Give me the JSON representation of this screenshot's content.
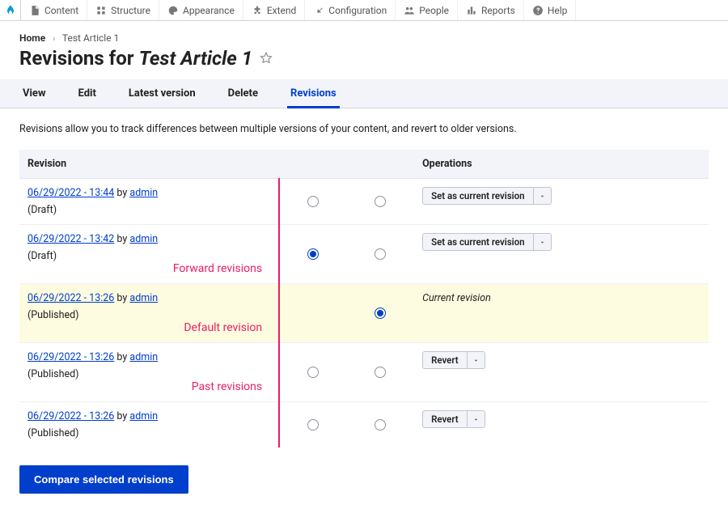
{
  "toolbar": {
    "items": [
      {
        "label": "Content"
      },
      {
        "label": "Structure"
      },
      {
        "label": "Appearance"
      },
      {
        "label": "Extend"
      },
      {
        "label": "Configuration"
      },
      {
        "label": "People"
      },
      {
        "label": "Reports"
      },
      {
        "label": "Help"
      }
    ]
  },
  "breadcrumb": {
    "home": "Home",
    "current": "Test Article 1"
  },
  "title": {
    "prefix": "Revisions for ",
    "subject": "Test Article 1"
  },
  "tabs": {
    "items": [
      "View",
      "Edit",
      "Latest version",
      "Delete",
      "Revisions"
    ],
    "active": 4
  },
  "help": "Revisions allow you to track differences between multiple versions of your content, and revert to older versions.",
  "table": {
    "headers": {
      "revision": "Revision",
      "operations": "Operations"
    },
    "by_label": "by",
    "rows": [
      {
        "date": "06/29/2022 - 13:44",
        "author": "admin",
        "status": "(Draft)",
        "radio_a": false,
        "radio_b": false,
        "op_type": "set",
        "annotation": ""
      },
      {
        "date": "06/29/2022 - 13:42",
        "author": "admin",
        "status": "(Draft)",
        "radio_a": true,
        "radio_b": false,
        "op_type": "set",
        "annotation": "Forward revisions"
      },
      {
        "date": "06/29/2022 - 13:26",
        "author": "admin",
        "status": "(Published)",
        "radio_a": null,
        "radio_b": true,
        "current": true,
        "op_type": "current",
        "annotation": "Default revision"
      },
      {
        "date": "06/29/2022 - 13:26",
        "author": "admin",
        "status": "(Published)",
        "radio_a": false,
        "radio_b": false,
        "op_type": "revert",
        "annotation": "Past revisions"
      },
      {
        "date": "06/29/2022 - 13:26",
        "author": "admin",
        "status": "(Published)",
        "radio_a": false,
        "radio_b": false,
        "op_type": "revert",
        "annotation": ""
      }
    ]
  },
  "ops": {
    "set": "Set as current revision",
    "revert": "Revert",
    "current": "Current revision"
  },
  "compare_button": "Compare selected revisions"
}
